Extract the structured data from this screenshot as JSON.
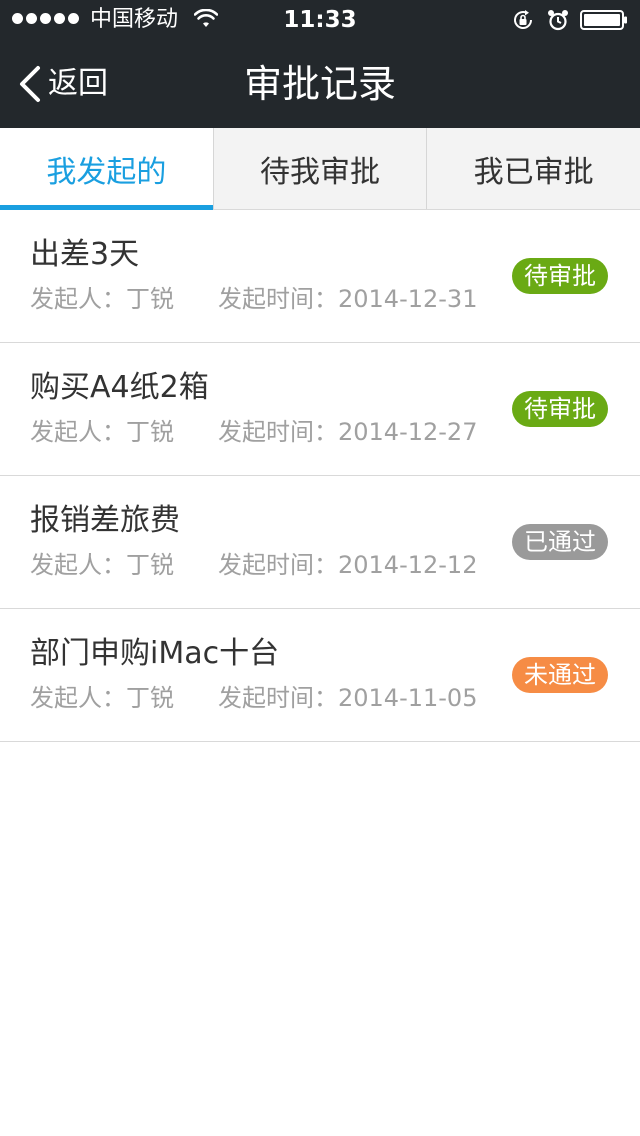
{
  "status_bar": {
    "carrier": "中国移动",
    "time": "11:33"
  },
  "navbar": {
    "back_label": "返回",
    "title": "审批记录"
  },
  "tabs": [
    {
      "label": "我发起的",
      "active": true
    },
    {
      "label": "待我审批",
      "active": false
    },
    {
      "label": "我已审批",
      "active": false
    }
  ],
  "records": [
    {
      "title": "出差3天",
      "initiator": "发起人：丁锐",
      "time": "发起时间：2014-12-31",
      "status": "待审批"
    },
    {
      "title": "购买A4纸2箱",
      "initiator": "发起人：丁锐",
      "time": "发起时间：2014-12-27",
      "status": "待审批"
    },
    {
      "title": "报销差旅费",
      "initiator": "发起人：丁锐",
      "time": "发起时间：2014-12-12",
      "status": "已通过"
    },
    {
      "title": "部门申购iMac十台",
      "initiator": "发起人：丁锐",
      "time": "发起时间：2014-11-05",
      "status": "未通过"
    }
  ],
  "colors": {
    "header_bg": "#23282c",
    "accent": "#1a9fe0",
    "pending": "#6aaa14",
    "passed": "#9a9a9a",
    "rejected": "#f68c45"
  }
}
